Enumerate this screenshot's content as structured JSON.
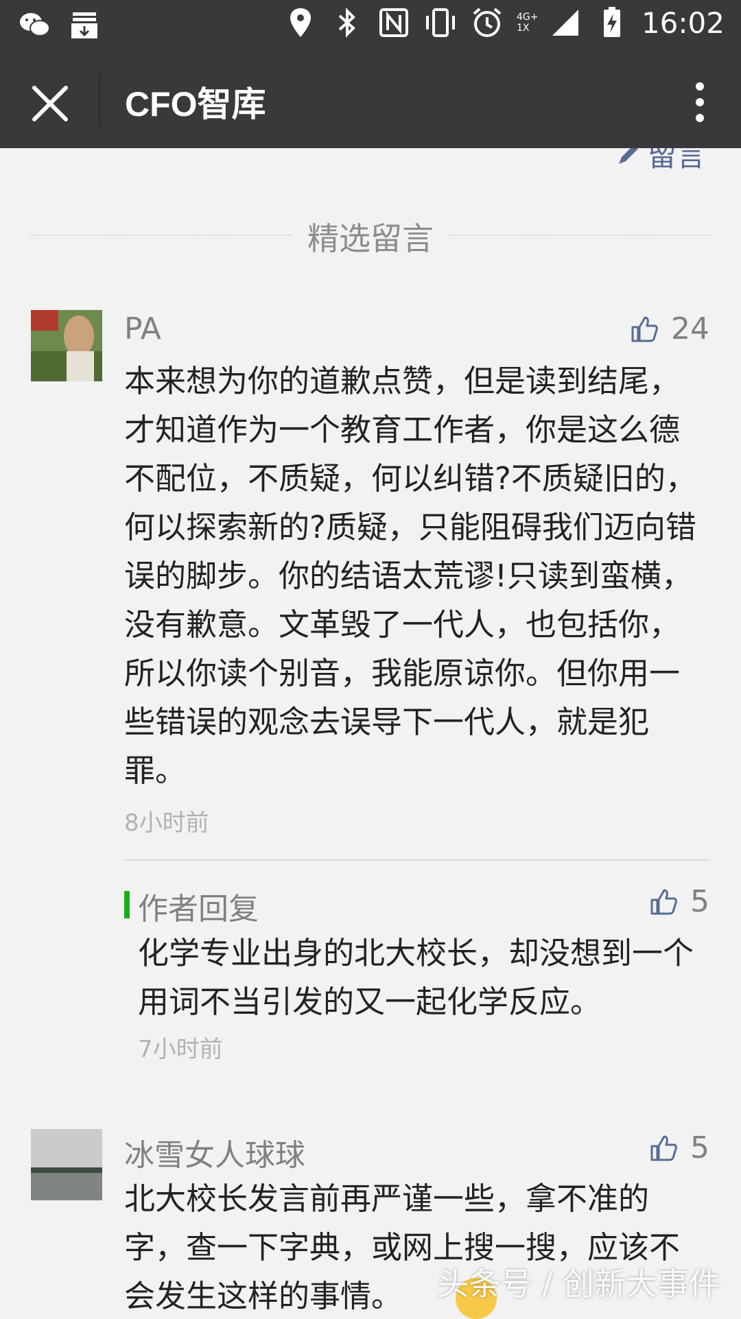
{
  "status_bar": {
    "time": "16:02",
    "network": "4G+ 1X",
    "icons": [
      "wechat-icon",
      "download-icon",
      "location-icon",
      "bluetooth-icon",
      "nfc-icon",
      "vibrate-icon",
      "alarm-icon",
      "signal-icon",
      "battery-charging-icon"
    ]
  },
  "title_bar": {
    "title": "CFO智库",
    "close_icon": "close-icon",
    "more_icon": "more-vertical-icon"
  },
  "top_link": {
    "label": "留言"
  },
  "section": {
    "title": "精选留言"
  },
  "comments": [
    {
      "name": "PA",
      "likes": "24",
      "text": "本来想为你的道歉点赞，但是读到结尾，才知道作为一个教育工作者，你是这么德不配位，不质疑，何以纠错?不质疑旧的，何以探索新的?质疑，只能阻碍我们迈向错误的脚步。你的结语太荒谬!只读到蛮横，没有歉意。文革毁了一代人，也包括你，所以你读个别音，我能原谅你。但你用一些错误的观念去误导下一代人，就是犯罪。",
      "time": "8小时前",
      "reply": {
        "label": "作者回复",
        "likes": "5",
        "text": "化学专业出身的北大校长，却没想到一个用词不当引发的又一起化学反应。",
        "time": "7小时前"
      }
    },
    {
      "name": "冰雪女人球球",
      "likes": "5",
      "text": "北大校长发言前再严谨一些，拿不准的字，查一下字典，或网上搜一搜，应该不会发生这样的事情。"
    }
  ],
  "watermark": "头条号 / 创新大事件",
  "colors": {
    "header_bg": "#39393b",
    "page_bg": "#f2f2f2",
    "link": "#576b95",
    "reply_accent": "#1aad19"
  }
}
